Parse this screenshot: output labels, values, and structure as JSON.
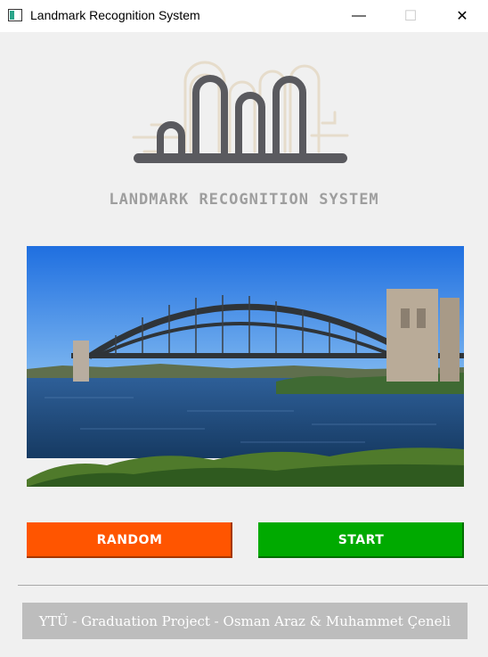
{
  "window": {
    "title": "Landmark Recognition System",
    "controls": {
      "minimize": "—",
      "maximize": "☐",
      "close": "✕"
    }
  },
  "header": {
    "logo_icon": "landmark-skyline-icon",
    "title": "LANDMARK RECOGNITION SYSTEM"
  },
  "preview": {
    "subject": "harbour-bridge-photo"
  },
  "actions": {
    "random_label": "RANDOM",
    "start_label": "START"
  },
  "footer": {
    "text": "YTÜ - Graduation Project - Osman Araz & Muhammet Çeneli"
  },
  "colors": {
    "random": "#ff5500",
    "start": "#00aa00",
    "title_gray": "#9e9e9e",
    "footer_bg": "#bdbdbd",
    "logo_dark": "#5a5a5f",
    "logo_light": "#e6dccb"
  }
}
